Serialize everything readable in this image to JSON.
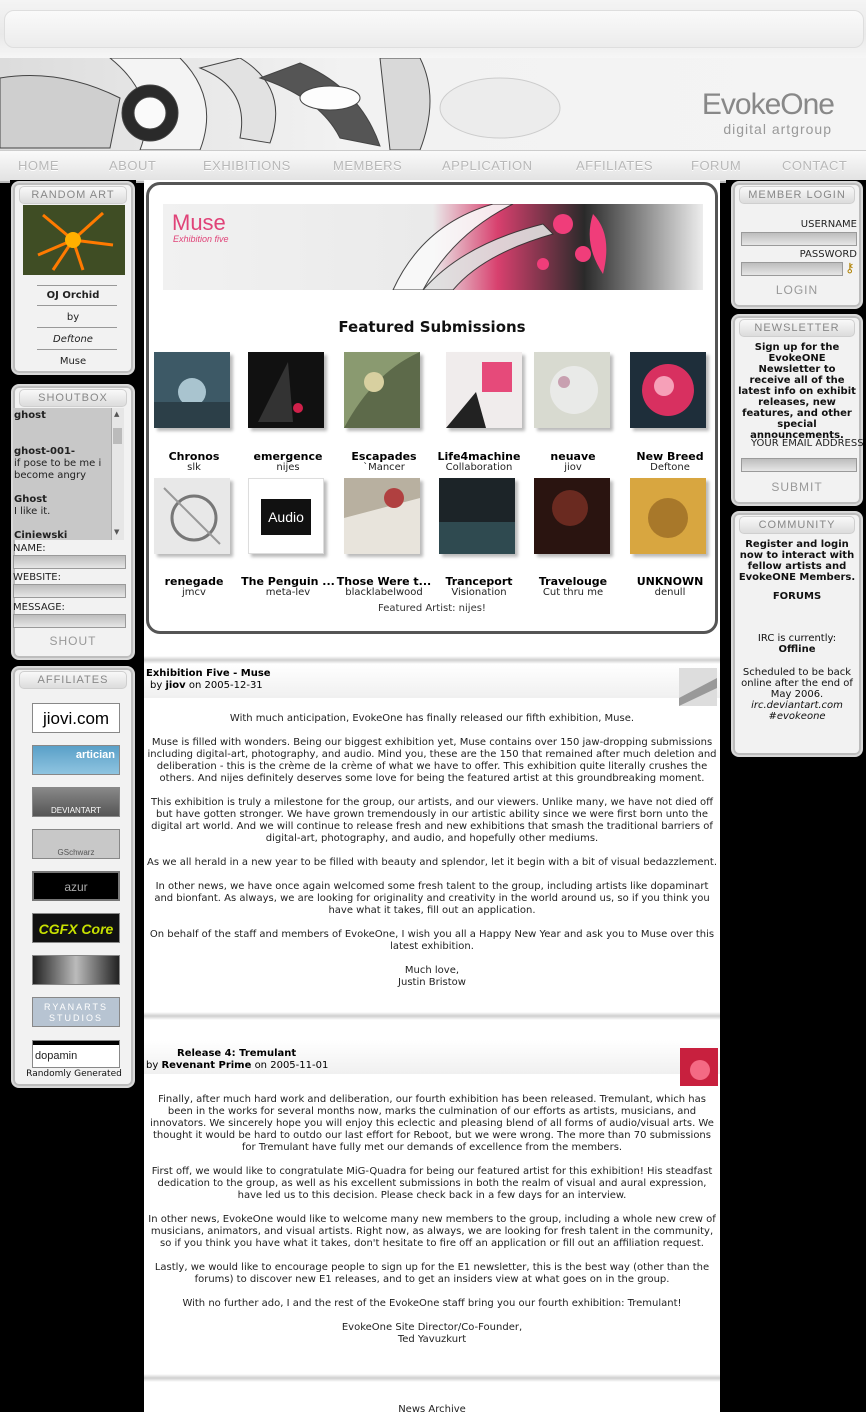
{
  "brand": {
    "logo_main": "EvokeOne",
    "logo_sub": "digital artgroup"
  },
  "nav": [
    "HOME",
    "ABOUT",
    "EXHIBITIONS",
    "MEMBERS",
    "APPLICATION",
    "AFFILIATES",
    "FORUM",
    "CONTACT"
  ],
  "random_art": {
    "heading": "RANDOM ART",
    "title": "OJ Orchid",
    "by": "by",
    "artist": "Deftone",
    "exhibition": "Muse"
  },
  "shoutbox": {
    "heading": "SHOUTBOX",
    "messages": [
      {
        "name": "ghost",
        "text": ""
      },
      {
        "name": "ghost-001-",
        "text": "if pose to be me i become angry"
      },
      {
        "name": "Ghost",
        "text": "I like it."
      },
      {
        "name": "Ciniewski",
        "text": ""
      }
    ],
    "name_label": "NAME:",
    "website_label": "WEBSITE:",
    "message_label": "MESSAGE:",
    "shout_button": "SHOUT"
  },
  "affiliates": {
    "heading": "AFFILIATES",
    "items": [
      "jiovi.com",
      "artician",
      "DEVIANTART",
      "GSchwarz",
      "azur",
      "CGFX Core",
      "",
      "RYANARTS STUDIOS",
      "dopamin"
    ],
    "footer": "Randomly Generated"
  },
  "featured": {
    "banner_title": "Muse",
    "banner_sub": "Exhibition five",
    "heading": "Featured Submissions",
    "items": [
      {
        "title": "Chronos",
        "artist": "slk"
      },
      {
        "title": "emergence",
        "artist": "nijes"
      },
      {
        "title": "Escapades",
        "artist": "`Mancer"
      },
      {
        "title": "Life4machine",
        "artist": "Collaboration"
      },
      {
        "title": "neuave",
        "artist": "jiov"
      },
      {
        "title": "New Breed",
        "artist": "Deftone"
      },
      {
        "title": "renegade",
        "artist": "jmcv"
      },
      {
        "title": "The Penguin ...",
        "artist": "meta-lev"
      },
      {
        "title": "Those Were t...",
        "artist": "blacklabelwood"
      },
      {
        "title": "Tranceport",
        "artist": "Visionation"
      },
      {
        "title": "Travelouge",
        "artist": "Cut thru me"
      },
      {
        "title": "UNKNOWN",
        "artist": "denull"
      }
    ],
    "featured_artist": "Featured Artist: nijes!",
    "penguin_thumb_text": "Audio"
  },
  "news": [
    {
      "title": "Exhibition Five - Muse",
      "by": "by",
      "author": "jiov",
      "on": "on",
      "date": "2005-12-31",
      "paragraphs": [
        "With much anticipation, EvokeOne has finally released our fifth exhibition, Muse.",
        "Muse is filled with wonders. Being our biggest exhibition yet, Muse contains over 150 jaw-dropping submissions including digital-art, photography, and audio. Mind you, these are the 150 that remained after much deletion and deliberation - this is the crème de la crème of what we have to offer. This exhibition quite literally crushes the others. And nijes definitely deserves some love for being the featured artist at this groundbreaking moment.",
        "This exhibition is truly a milestone for the group, our artists, and our viewers. Unlike many, we have not died off but have gotten stronger. We have grown tremendously in our artistic ability since we were first born unto the digital art world. And we will continue to release fresh and new exhibitions that smash the traditional barriers of digital-art, photography, and audio, and hopefully other mediums.",
        "As we all herald in a new year to be filled with beauty and splendor, let it begin with a bit of visual bedazzlement.",
        "In other news, we have once again welcomed some fresh talent to the group, including artists like dopaminart and bionfant. As always, we are looking for originality and creativity in the world around us, so if you think you have what it takes, fill out an application.",
        "On behalf of the staff and members of EvokeOne, I wish you all a Happy New Year and ask you to Muse over this latest exhibition.",
        "Much love,\nJustin Bristow"
      ]
    },
    {
      "title": "Release 4: Tremulant",
      "by": "by",
      "author": "Revenant Prime",
      "on": "on",
      "date": "2005-11-01",
      "paragraphs": [
        "Finally, after much hard work and deliberation, our fourth exhibition has been released. Tremulant, which has been in the works for several months now, marks the culmination of our efforts as artists, musicians, and innovators. We sincerely hope you will enjoy this eclectic and pleasing blend of all forms of audio/visual arts. We thought it would be hard to outdo our last effort for Reboot, but we were wrong. The more than 70 submissions for Tremulant have fully met our demands of excellence from the members.",
        "First off, we would like to congratulate MiG-Quadra for being our featured artist for this exhibition! His steadfast dedication to the group, as well as his excellent submissions in both the realm of visual and aural expression, have led us to this decision. Please check back in a few days for an interview.",
        "In other news, EvokeOne would like to welcome many new members to the group, including a whole new crew of musicians, animators, and visual artists. Right now, as always, we are looking for fresh talent in the community, so if you think you have what it takes, don't hesitate to fire off an application or fill out an affiliation request.",
        "Lastly, we would like to encourage people to sign up for the E1 newsletter, this is the best way (other than the forums) to discover new E1 releases, and to get an insiders view at what goes on in the group.",
        "With no further ado, I and the rest of the EvokeOne staff bring you our fourth exhibition: Tremulant!",
        "EvokeOne Site Director/Co-Founder,\nTed Yavuzkurt"
      ]
    }
  ],
  "news_archive": "News Archive",
  "member_login": {
    "heading": "MEMBER LOGIN",
    "username_label": "USERNAME",
    "password_label": "PASSWORD",
    "login_button": "LOGIN"
  },
  "newsletter": {
    "heading": "NEWSLETTER",
    "text": "Sign up for the EvokeONE Newsletter to receive all of the latest info on exhibit releases, new features, and other special announcements.",
    "email_label": "YOUR EMAIL ADDRESS",
    "submit_button": "SUBMIT"
  },
  "community": {
    "heading": "COMMUNITY",
    "text": "Register and login now to interact with fellow artists and EvokeONE Members.",
    "forums_link": "FORUMS",
    "irc_label": "IRC is currently:",
    "irc_status": "Offline",
    "irc_note": "Scheduled to be back online after the end of May 2006.",
    "irc_server": "irc.deviantart.com",
    "irc_channel": "#evokeone"
  }
}
